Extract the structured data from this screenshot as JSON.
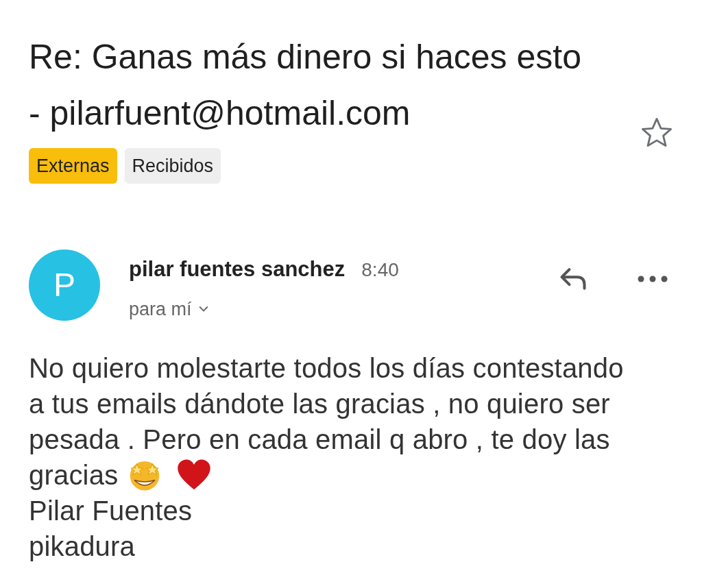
{
  "subject": "Re: Ganas más dinero si haces esto - pilarfuent@hotmail.com",
  "starred": false,
  "labels": [
    {
      "text": "Externas",
      "color": "#f9bd0b"
    },
    {
      "text": "Recibidos",
      "color": "#eeeeee"
    }
  ],
  "message": {
    "avatar_letter": "P",
    "sender": "pilar fuentes sanchez",
    "time": "8:40",
    "recipient": "para mí",
    "body_lines": [
      "No quiero molestarte todos los días contestando",
      "a tus emails dándote las gracias , no quiero ser",
      "pesada . Pero en cada email q abro , te doy las",
      "gracias"
    ],
    "emojis": [
      {
        "kind": "star-struck"
      },
      {
        "kind": "heart"
      }
    ],
    "signature": [
      "Pilar Fuentes",
      "pikadura"
    ]
  }
}
